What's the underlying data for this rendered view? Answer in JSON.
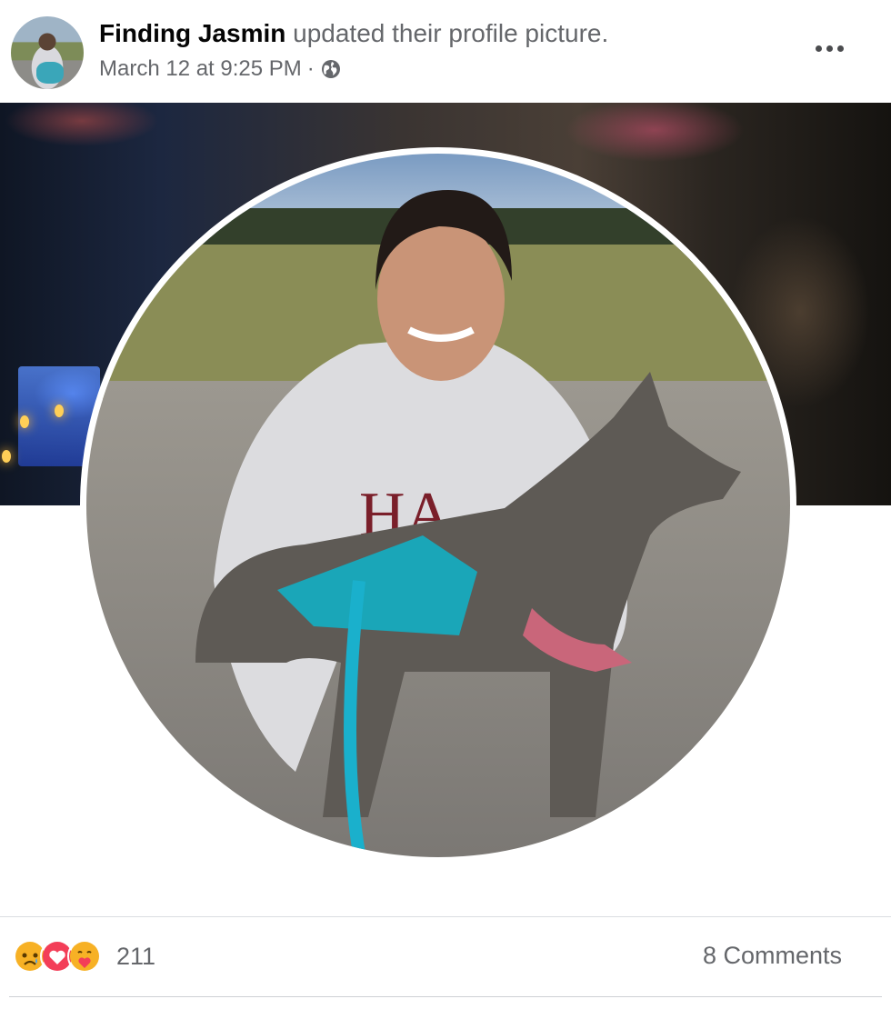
{
  "post": {
    "author_name": "Finding Jasmin",
    "action_text": "updated their profile picture.",
    "timestamp": "March 12 at 9:25 PM",
    "separator": "·",
    "privacy_icon": "globe-icon",
    "menu_icon": "more-options-icon"
  },
  "reactions": {
    "icons": [
      "sad-reaction-icon",
      "love-reaction-icon",
      "care-reaction-icon"
    ],
    "count": "211"
  },
  "comments": {
    "label": "8 Comments"
  },
  "colors": {
    "secondary_text": "#65676b",
    "love": "#f33e58",
    "reaction_yellow": "#f7b125"
  }
}
